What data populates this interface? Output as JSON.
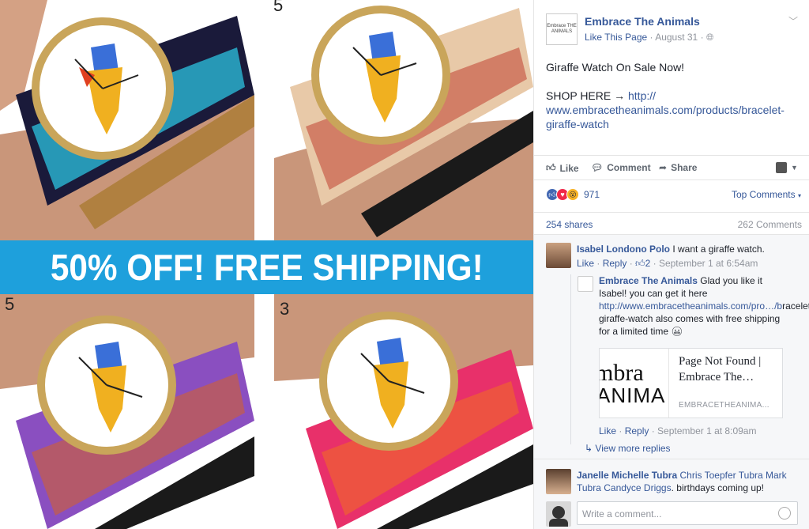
{
  "photo": {
    "banner": "50% OFF! FREE SHIPPING!",
    "cell_numbers": [
      "5",
      "5",
      "3"
    ],
    "strap_colors": [
      "#2bb8d6",
      "#e8c9a8",
      "#8a4fc0",
      "#e8306a"
    ]
  },
  "post": {
    "page_name": "Embrace The Animals",
    "logo_text": "Embrace THE ANIMALS",
    "like_page": "Like This Page",
    "date": "August 31",
    "line1": "Giraffe Watch On Sale Now!",
    "shop_label": "SHOP HERE →",
    "link": "http:// www.embracetheanimals.com/products/bracelet-giraffe-watch"
  },
  "actions": {
    "like": "Like",
    "comment": "Comment",
    "share": "Share"
  },
  "reactions": {
    "count": "971",
    "top_comments": "Top Comments"
  },
  "stats": {
    "shares": "254 shares",
    "comments": "262 Comments"
  },
  "comments": [
    {
      "name": "Isabel Londono Polo",
      "text": "I want a giraffe watch.",
      "like": "Like",
      "reply": "Reply",
      "likes": "2",
      "time": "September 1 at 6:54am"
    },
    {
      "name": "Embrace The Animals",
      "text1": "Glad you like it Isabel! you can get it here",
      "link": "http://www.embracetheanimals.com/pro…/b",
      "text2": "racelet-giraffe-watch also comes with free shipping for a limited time",
      "like": "Like",
      "reply": "Reply",
      "time": "September 1 at 8:09am",
      "preview_title": "Page Not Found | Embrace The…",
      "preview_domain": "EMBRACETHEANIMA...",
      "preview_logo_top": "mbra",
      "preview_logo_bottom": "ANIMA"
    },
    {
      "name": "Janelle Michelle Tubra",
      "tags": "Chris Toepfer Tubra Mark Tubra Candyce Driggs",
      "text": ". birthdays coming up!"
    }
  ],
  "view_more": "View more replies",
  "write_placeholder": "Write a comment..."
}
